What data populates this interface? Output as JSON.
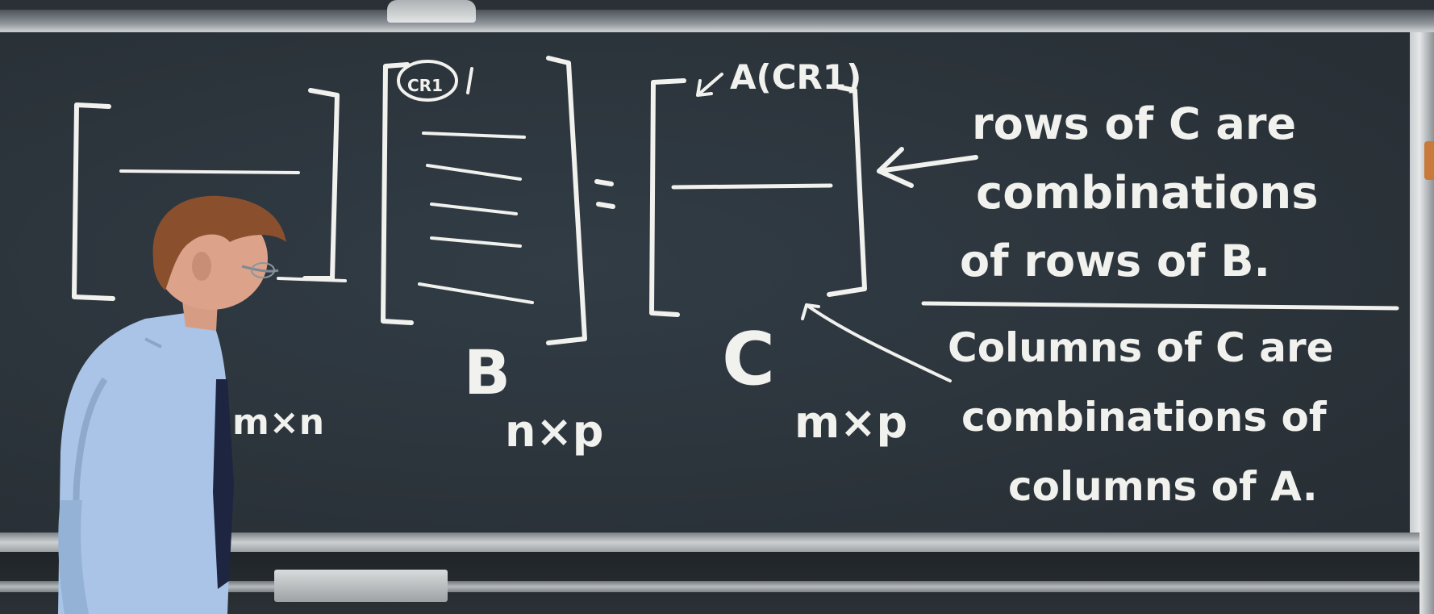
{
  "board": {
    "label_B": "B",
    "label_C": "C",
    "dim_A": "m×n",
    "dim_B": "n×p",
    "dim_C": "m×p",
    "entry_label": "A(CR1)",
    "b_row_marker": "CR1"
  },
  "statements": {
    "rows_line1": "rows of C are",
    "rows_line2": "combinations",
    "rows_line3": "of rows of B.",
    "cols_line1": "Columns of C are",
    "cols_line2": "combinations of",
    "cols_line3": "columns of A."
  },
  "colors": {
    "chalkboard": "#2e363d",
    "chalk": "#f1f1ee",
    "shirt": "#a9c4e6",
    "tie": "#1d2540"
  }
}
